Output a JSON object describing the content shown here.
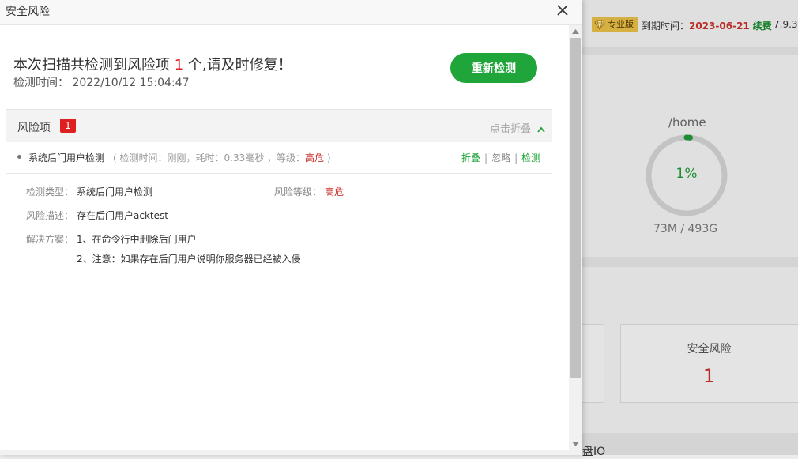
{
  "background": {
    "pro_badge": "专业版",
    "expire_label": "到期时间：",
    "expire_date": "2023-06-21",
    "renew": "续费",
    "version": "7.9.3",
    "disk_path": "/home",
    "disk_usage_percent": 1,
    "disk_usage_text": "1%",
    "disk_size": "73M / 493G",
    "security_risk_label": "安全风险",
    "security_risk_count": "1",
    "io_label": "盘IO"
  },
  "dialog": {
    "title": "安全风险",
    "summary_prefix": "本次扫描共检测到风险项 ",
    "summary_count": "1",
    "summary_suffix": " 个,请及时修复！",
    "scan_time_label": "检测时间：",
    "scan_time": "2022/10/12 15:04:47",
    "rescan_button": "重新检测",
    "risk_section": {
      "label": "风险项",
      "count": "1",
      "collapse_link": "点击折叠"
    },
    "item": {
      "name": "系统后门用户检测",
      "meta_prefix": "( 检测时间：刚刚，耗时：0.33毫秒 ，等级：",
      "level": "高危",
      "meta_suffix": " )",
      "actions": {
        "fold": "折叠",
        "ignore": "忽略",
        "check": "检测"
      }
    },
    "details": {
      "type_label": "检测类型：",
      "type_value": "系统后门用户检测",
      "level_label": "风险等级：",
      "level_value": "高危",
      "desc_label": "风险描述：",
      "desc_value": "存在后门用户acktest",
      "solution_label": "解决方案：",
      "solution_1": "1、在命令行中删除后门用户",
      "solution_2": "2、注意：如果存在后门用户说明你服务器已经被入侵"
    }
  },
  "colors": {
    "primary_green": "#20a53a",
    "danger_red": "#e02020",
    "gold": "#e8c04a"
  },
  "icons": {
    "close": "close-icon",
    "chevron_up": "chevron-up-icon",
    "gem": "diamond-icon"
  }
}
